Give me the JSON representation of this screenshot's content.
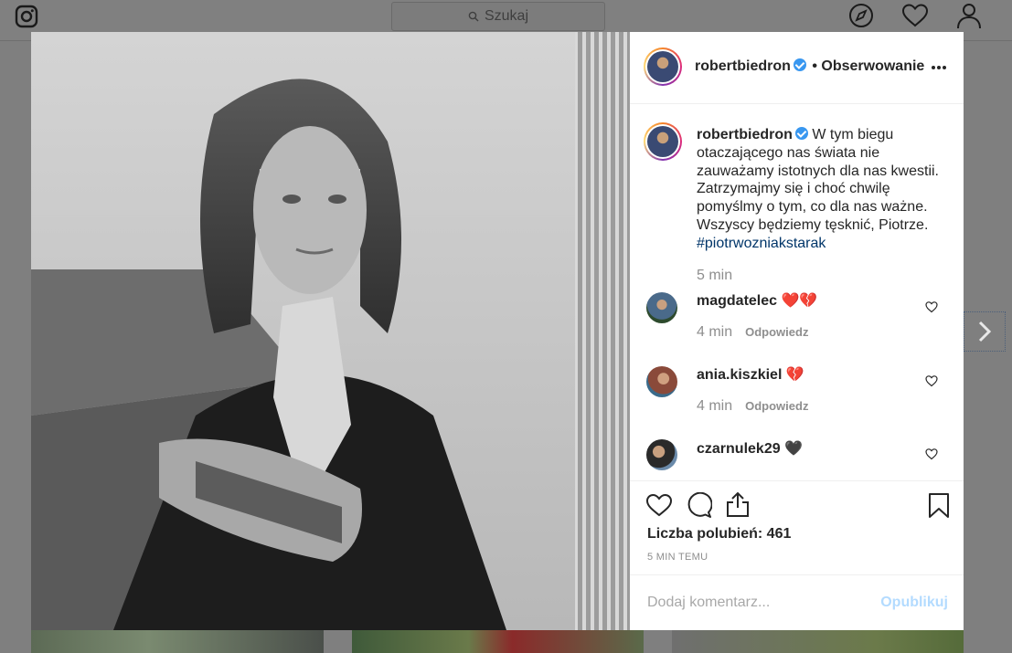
{
  "topbar": {
    "search_placeholder": "Szukaj"
  },
  "post": {
    "username": "robertbiedron",
    "follow_label": "• Obserwowanie",
    "caption_text": "W tym biegu otaczającego nas świata nie zauważamy istotnych dla nas kwestii. Zatrzymajmy się i choć chwilę pomyślmy o tym, co dla nas ważne. Wszyscy będziemy tęsknić, Piotrze.",
    "caption_hashtag": "#piotrwozniakstarak",
    "caption_time": "5 min",
    "comments": [
      {
        "username": "magdatelec",
        "text": "❤️💔",
        "time": "4 min",
        "reply_label": "Odpowiedz"
      },
      {
        "username": "ania.kiszkiel",
        "text": "💔",
        "time": "4 min",
        "reply_label": "Odpowiedz"
      },
      {
        "username": "czarnulek29",
        "text": "🖤",
        "time": "",
        "reply_label": ""
      }
    ],
    "likes_label": "Liczba polubień: 461",
    "posted_ago": "5 MIN TEMU",
    "comment_placeholder": "Dodaj komentarz...",
    "publish_label": "Opublikuj"
  },
  "colors": {
    "verified": "#3897f0",
    "hashtag": "#003569",
    "publish_disabled": "#b3dbff"
  },
  "icons": [
    "instagram-logo-icon",
    "search-icon",
    "compass-icon",
    "heart-icon",
    "profile-icon",
    "more-options-icon",
    "like-icon",
    "comment-icon",
    "share-icon",
    "bookmark-icon",
    "chevron-right-icon"
  ]
}
